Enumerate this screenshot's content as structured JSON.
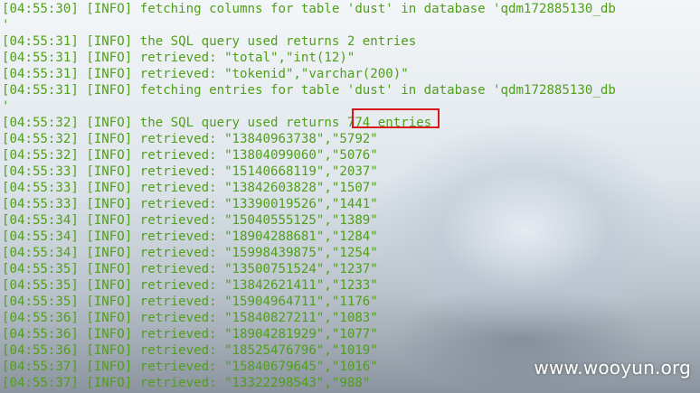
{
  "log_lines": [
    "[04:55:30] [INFO] fetching columns for table 'dust' in database 'qdm172885130_db",
    "'",
    "[04:55:31] [INFO] the SQL query used returns 2 entries",
    "[04:55:31] [INFO] retrieved: \"total\",\"int(12)\"",
    "[04:55:31] [INFO] retrieved: \"tokenid\",\"varchar(200)\"",
    "[04:55:31] [INFO] fetching entries for table 'dust' in database 'qdm172885130_db",
    "'",
    "[04:55:32] [INFO] the SQL query used returns 774 entries",
    "[04:55:32] [INFO] retrieved: \"13840963738\",\"5792\"",
    "[04:55:32] [INFO] retrieved: \"13804099060\",\"5076\"",
    "[04:55:33] [INFO] retrieved: \"15140668119\",\"2037\"",
    "[04:55:33] [INFO] retrieved: \"13842603828\",\"1507\"",
    "[04:55:33] [INFO] retrieved: \"13390019526\",\"1441\"",
    "[04:55:34] [INFO] retrieved: \"15040555125\",\"1389\"",
    "[04:55:34] [INFO] retrieved: \"18904288681\",\"1284\"",
    "[04:55:34] [INFO] retrieved: \"15998439875\",\"1254\"",
    "[04:55:35] [INFO] retrieved: \"13500751524\",\"1237\"",
    "[04:55:35] [INFO] retrieved: \"13842621411\",\"1233\"",
    "[04:55:35] [INFO] retrieved: \"15904964711\",\"1176\"",
    "[04:55:36] [INFO] retrieved: \"15840827211\",\"1083\"",
    "[04:55:36] [INFO] retrieved: \"18904281929\",\"1077\"",
    "[04:55:36] [INFO] retrieved: \"18525476796\",\"1019\"",
    "[04:55:37] [INFO] retrieved: \"15840679645\",\"1016\"",
    "[04:55:37] [INFO] retrieved: \"13322298543\",\"988\""
  ],
  "watermark": "www.wooyun.org",
  "colors": {
    "terminal_text": "#4f9f18",
    "highlight_border": "#d9141b"
  }
}
